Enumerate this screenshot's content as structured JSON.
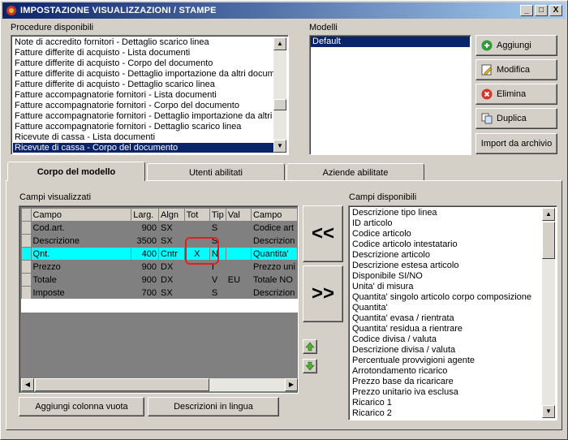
{
  "window": {
    "title": "IMPOSTAZIONE VISUALIZZAZIONI / STAMPE",
    "min": "_",
    "max": "□",
    "close": "X"
  },
  "procedure": {
    "label": "Procedure disponibili",
    "items": [
      "Note di accredito fornitori - Dettaglio scarico linea",
      "Fatture differite di acquisto - Lista documenti",
      "Fatture differite di acquisto - Corpo del documento",
      "Fatture differite di acquisto - Dettaglio importazione da altri documen",
      "Fatture differite di acquisto - Dettaglio scarico linea",
      "Fatture accompagnatorie fornitori - Lista documenti",
      "Fatture accompagnatorie fornitori - Corpo del documento",
      "Fatture accompagnatorie fornitori - Dettaglio importazione da altri do",
      "Fatture accompagnatorie fornitori - Dettaglio scarico linea",
      "Ricevute di cassa - Lista documenti",
      "Ricevute di cassa - Corpo del documento"
    ],
    "selected_index": 10
  },
  "modelli": {
    "label": "Modelli",
    "items": [
      "Default"
    ],
    "selected_index": 0
  },
  "actions": {
    "aggiungi": "Aggiungi",
    "modifica": "Modifica",
    "elimina": "Elimina",
    "duplica": "Duplica",
    "importa": "Import da archivio"
  },
  "tabs": [
    "Corpo del modello",
    "Utenti abilitati",
    "Aziende abilitate"
  ],
  "campi_visualizzati": {
    "label": "Campi visualizzati",
    "columns": [
      "Campo",
      "Larg.",
      "Algn",
      "Tot",
      "Tip",
      "Val",
      "Campo"
    ],
    "rows": [
      [
        "Cod.art.",
        "900",
        "SX",
        "",
        "S",
        "",
        "Codice art"
      ],
      [
        "Descrizione",
        "3500",
        "SX",
        "",
        "S",
        "",
        "Descrizion"
      ],
      [
        "Qnt.",
        "400",
        "Cntr",
        "X",
        "N",
        "",
        "Quantita'"
      ],
      [
        "Prezzo",
        "900",
        "DX",
        "",
        "I",
        "",
        "Prezzo uni"
      ],
      [
        "Totale",
        "900",
        "DX",
        "",
        "V",
        "EU",
        "Totale NO"
      ],
      [
        "Imposte",
        "700",
        "SX",
        "",
        "S",
        "",
        "Descrizion"
      ]
    ],
    "highlight_row": 2
  },
  "move": {
    "add_all": "<<",
    "remove": ">>"
  },
  "bottom_buttons": {
    "vuota": "Aggiungi colonna vuota",
    "lingua": "Descrizioni in lingua"
  },
  "campi_disponibili": {
    "label": "Campi disponibili",
    "items": [
      "Descrizione tipo linea",
      "ID articolo",
      "Codice articolo",
      "Codice articolo intestatario",
      "Descrizione articolo",
      "Descrizione estesa articolo",
      "Disponibile SI/NO",
      "Unita' di misura",
      "Quantita' singolo articolo corpo composizione",
      "Quantita'",
      "Quantita' evasa / rientrata",
      "Quantita' residua a rientrare",
      "Codice divisa / valuta",
      "Descrizione divisa / valuta",
      "Percentuale provvigioni agente",
      "Arrotondamento ricarico",
      "Prezzo base da ricaricare",
      "Prezzo unitario iva esclusa",
      "Ricarico 1",
      "Ricarico 2"
    ]
  }
}
